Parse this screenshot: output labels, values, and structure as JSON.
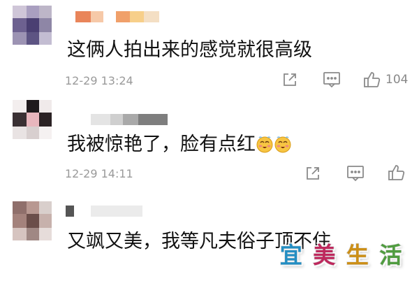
{
  "comments": [
    {
      "text": "这俩人拍出来的感觉就很高级",
      "time": "12-29 13:24",
      "like_count": "104"
    },
    {
      "text": "我被惊艳了，脸有点红",
      "time": "12-29 14:11",
      "like_count": ""
    },
    {
      "text": "又飒又美，我等凡夫俗子顶不住"
    }
  ],
  "icons": {
    "share": "share-icon",
    "reply": "comment-icon",
    "like": "thumbs-up-icon",
    "emoji": "blushing-face-emoji"
  },
  "watermark": {
    "chars": [
      "宜",
      "美",
      "生",
      "活"
    ]
  },
  "colors": {
    "meta_text": "#9a9a9a",
    "icon_gray": "#8a8a8a",
    "wm_blue": "#2aa7e6",
    "wm_pink": "#e0306e",
    "wm_orange": "#f0a81c",
    "wm_green": "#5db84a"
  }
}
